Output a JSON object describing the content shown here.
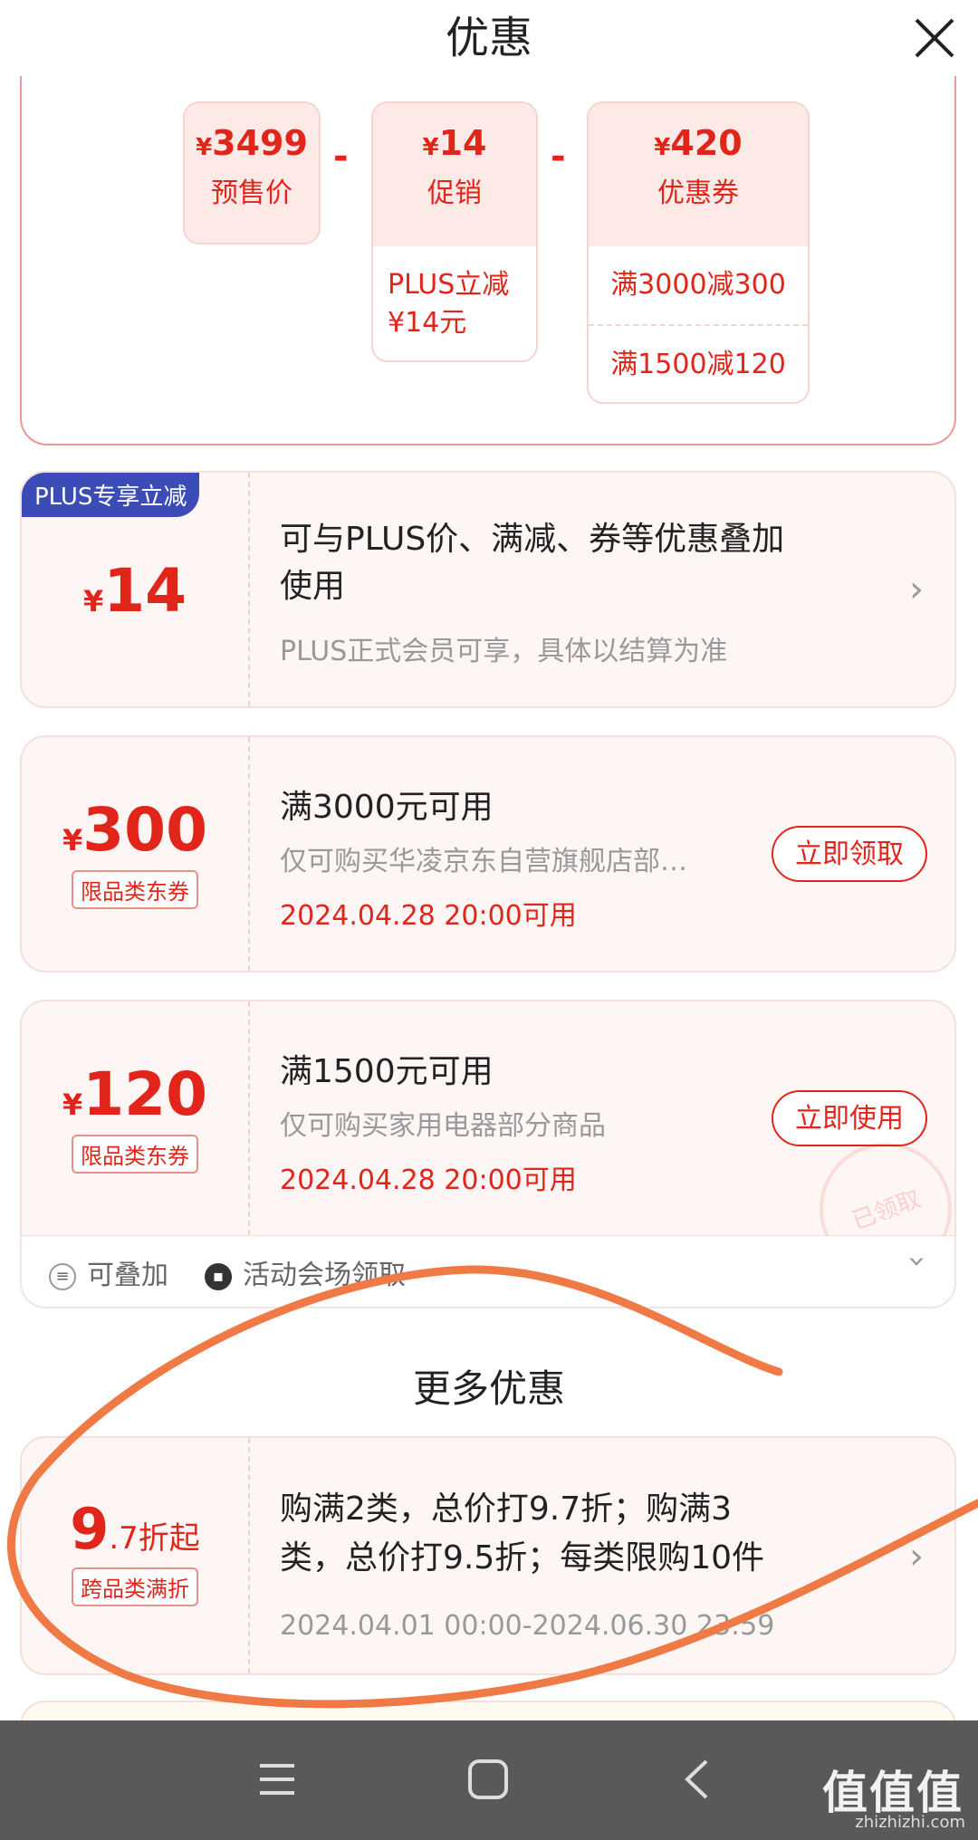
{
  "header": {
    "title": "优惠"
  },
  "breakdown": {
    "presale": {
      "currency": "¥",
      "amount": "3499",
      "label": "预售价"
    },
    "minus1": "-",
    "promo": {
      "currency": "¥",
      "amount": "14",
      "label": "促销",
      "detail": "PLUS立减 ¥14元"
    },
    "minus2": "-",
    "coupon": {
      "currency": "¥",
      "amount": "420",
      "label": "优惠券",
      "rule1": "满3000减300",
      "rule2": "满1500减120"
    }
  },
  "coupons": [
    {
      "badge": "PLUS专享立减",
      "currency": "¥",
      "amount": "14",
      "line1": "可与PLUS价、满减、券等优惠叠加使用",
      "line2": "PLUS正式会员可享，具体以结算为准"
    },
    {
      "currency": "¥",
      "amount": "300",
      "tag": "限品类东券",
      "line1": "满3000元可用",
      "line2": "仅可购买华凌京东自营旗舰店部…",
      "line3": "2024.04.28 20:00可用",
      "button": "立即领取"
    },
    {
      "currency": "¥",
      "amount": "120",
      "tag": "限品类东券",
      "line1": "满1500元可用",
      "line2": "仅可购买家用电器部分商品",
      "line3": "2024.04.28 20:00可用",
      "button": "立即使用",
      "stamp": "已领取"
    }
  ],
  "footer": {
    "stackable": "可叠加",
    "source": "活动会场领取"
  },
  "more": {
    "title": "更多优惠",
    "item": {
      "big": "9",
      "small": ".7折起",
      "tag": "跨品类满折",
      "line1": "购满2类，总价打9.7折；购满3",
      "line1b": "类，总价打9.5折；每类限购10件",
      "line2": "2024.04.01 00:00-2024.06.30 23:59"
    }
  },
  "watermark": {
    "logo": "值值值",
    "site": "zhizhizhi.com"
  },
  "colors": {
    "accent": "#e1251b",
    "plus": "#3b4cb7",
    "annotation": "#f07a45"
  },
  "icons": [
    "close-icon",
    "chevron-right-icon",
    "chevron-down-icon",
    "stack-icon",
    "ticket-icon",
    "menu-icon",
    "home-icon",
    "back-icon"
  ]
}
